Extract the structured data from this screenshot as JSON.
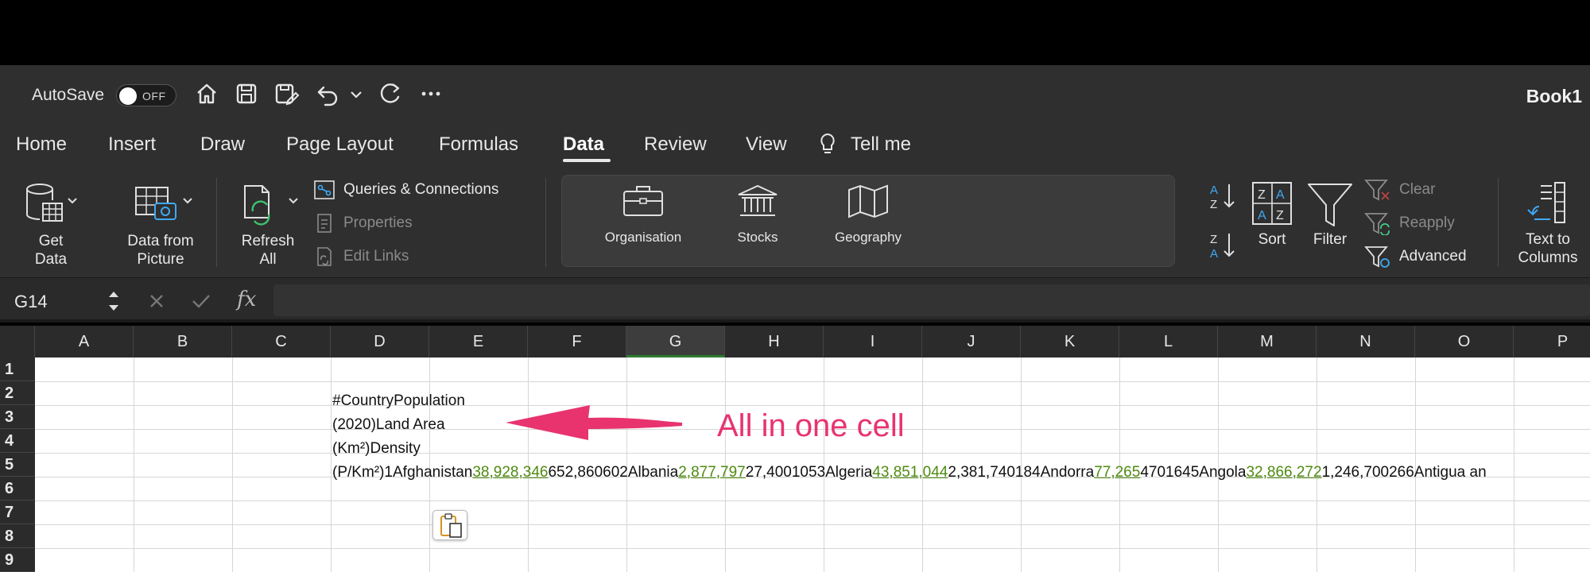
{
  "titlebar": {
    "autosave_label": "AutoSave",
    "autosave_state": "OFF",
    "book_title": "Book1"
  },
  "tabs": [
    {
      "label": "Home"
    },
    {
      "label": "Insert"
    },
    {
      "label": "Draw"
    },
    {
      "label": "Page Layout"
    },
    {
      "label": "Formulas"
    },
    {
      "label": "Data",
      "active": true
    },
    {
      "label": "Review"
    },
    {
      "label": "View"
    },
    {
      "label": "Tell me"
    }
  ],
  "ribbon": {
    "get_data": [
      "Get",
      "Data"
    ],
    "data_from_picture": [
      "Data from",
      "Picture"
    ],
    "refresh_all": [
      "Refresh",
      "All"
    ],
    "queries_connections": "Queries & Connections",
    "properties": "Properties",
    "edit_links": "Edit Links",
    "data_types": [
      "Organisation",
      "Stocks",
      "Geography"
    ],
    "sort": "Sort",
    "filter": "Filter",
    "clear": "Clear",
    "reapply": "Reapply",
    "advanced": "Advanced",
    "text_to_columns": [
      "Text to",
      "Columns"
    ]
  },
  "formula_bar": {
    "name_box": "G14",
    "fx_label": "fx",
    "content": ""
  },
  "grid": {
    "columns": [
      "A",
      "B",
      "C",
      "D",
      "E",
      "F",
      "G",
      "H",
      "I",
      "J",
      "K",
      "L",
      "M",
      "N",
      "O",
      "P"
    ],
    "selected_column": "G",
    "rows": [
      "1",
      "2",
      "3",
      "4",
      "5",
      "6",
      "7",
      "8",
      "9"
    ],
    "cells": {
      "D3": "#CountryPopulation",
      "D4": "(2020)Land Area",
      "D5": "(Km²)Density",
      "D6_parts": [
        {
          "text": "(P/Km²)1Afghanistan",
          "link": false
        },
        {
          "text": "38,928,346",
          "link": true
        },
        {
          "text": "652,860602Albania",
          "link": false
        },
        {
          "text": "2,877,797",
          "link": true
        },
        {
          "text": "27,4001053Algeria",
          "link": false
        },
        {
          "text": "43,851,044",
          "link": true
        },
        {
          "text": "2,381,740184Andorra",
          "link": false
        },
        {
          "text": "77,265",
          "link": true
        },
        {
          "text": "4701645Angola",
          "link": false
        },
        {
          "text": "32,866,272",
          "link": true
        },
        {
          "text": "1,246,700266Antigua an",
          "link": false
        }
      ]
    },
    "annotation": "All in one cell",
    "annotation_color": "#e8336f",
    "link_color": "#4f8a10"
  }
}
